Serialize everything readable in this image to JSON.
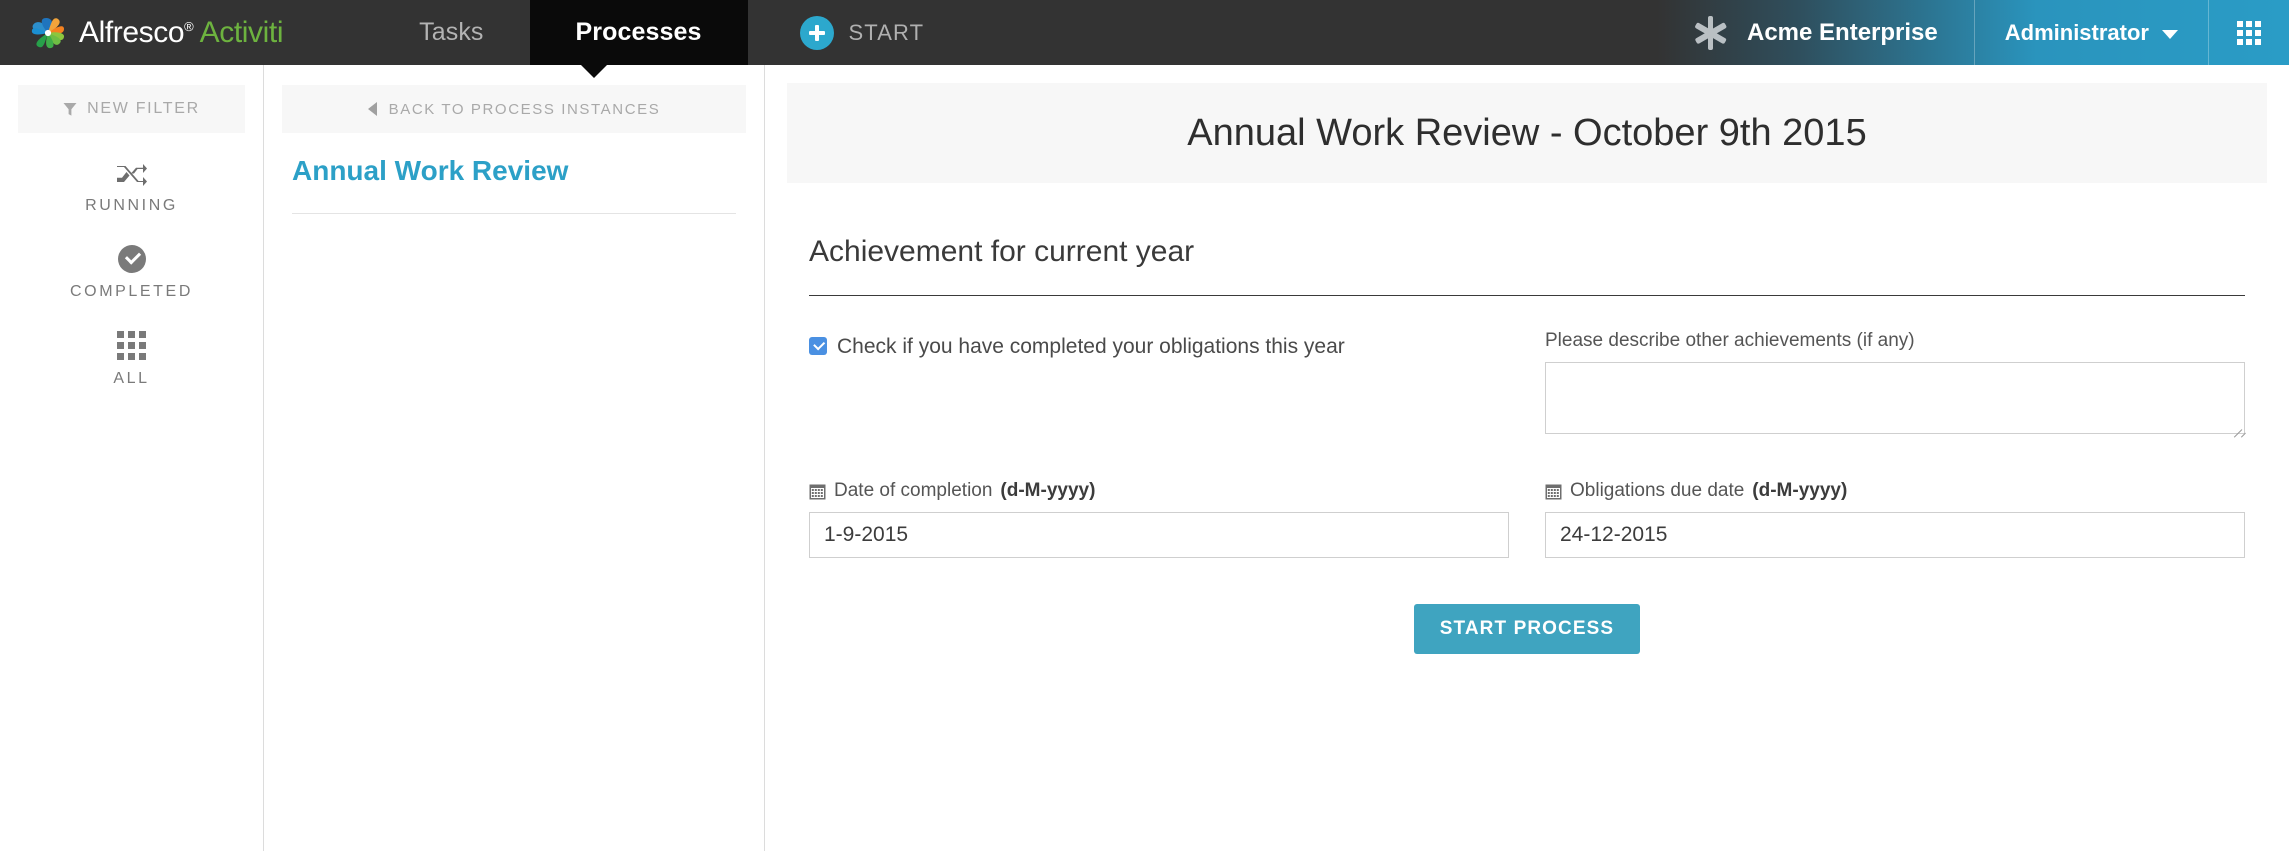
{
  "header": {
    "brand": {
      "primary": "Alfresco",
      "registered": "®",
      "secondary": "Activiti",
      "logo_icon": "alfresco-pinwheel-logo"
    },
    "tabs": [
      {
        "label": "Tasks",
        "active": false
      },
      {
        "label": "Processes",
        "active": true
      }
    ],
    "start_button": {
      "label": "START",
      "icon": "plus-circle-icon"
    },
    "tenant": {
      "name": "Acme Enterprise",
      "icon": "asterisk-icon"
    },
    "user": {
      "name": "Administrator",
      "icon": "chevron-down-icon"
    },
    "apps_icon": "grid-apps-icon",
    "colors": {
      "bar": "#333333",
      "active_tab": "#0a0a0a",
      "accent_teal": "#2ca8cd",
      "brand_green": "#6db33f"
    }
  },
  "sidebar": {
    "new_filter": {
      "label": "NEW FILTER",
      "icon": "funnel-icon"
    },
    "items": [
      {
        "label": "RUNNING",
        "icon": "shuffle-icon"
      },
      {
        "label": "COMPLETED",
        "icon": "check-circle-icon"
      },
      {
        "label": "ALL",
        "icon": "grid-dots-icon"
      }
    ]
  },
  "list_panel": {
    "back_link": {
      "label": "BACK TO PROCESS INSTANCES",
      "icon": "chevron-left-icon"
    },
    "selected_process": "Annual Work Review"
  },
  "form": {
    "title": "Annual Work Review - October 9th 2015",
    "section_heading": "Achievement for current year",
    "checkbox": {
      "label": "Check if you have completed your obligations this year",
      "checked": true,
      "color": "#4a90e2"
    },
    "achievements": {
      "label": "Please describe other achievements (if any)",
      "value": "",
      "placeholder": ""
    },
    "date_completion": {
      "label": "Date of completion ",
      "format": "(d-M-yyyy)",
      "value": "1-9-2015",
      "icon": "calendar-icon"
    },
    "date_obligations": {
      "label": "Obligations due date ",
      "format": "(d-M-yyyy)",
      "value": "24-12-2015",
      "icon": "calendar-icon"
    },
    "submit": {
      "label": "START PROCESS",
      "color": "#3fa4c0"
    }
  }
}
